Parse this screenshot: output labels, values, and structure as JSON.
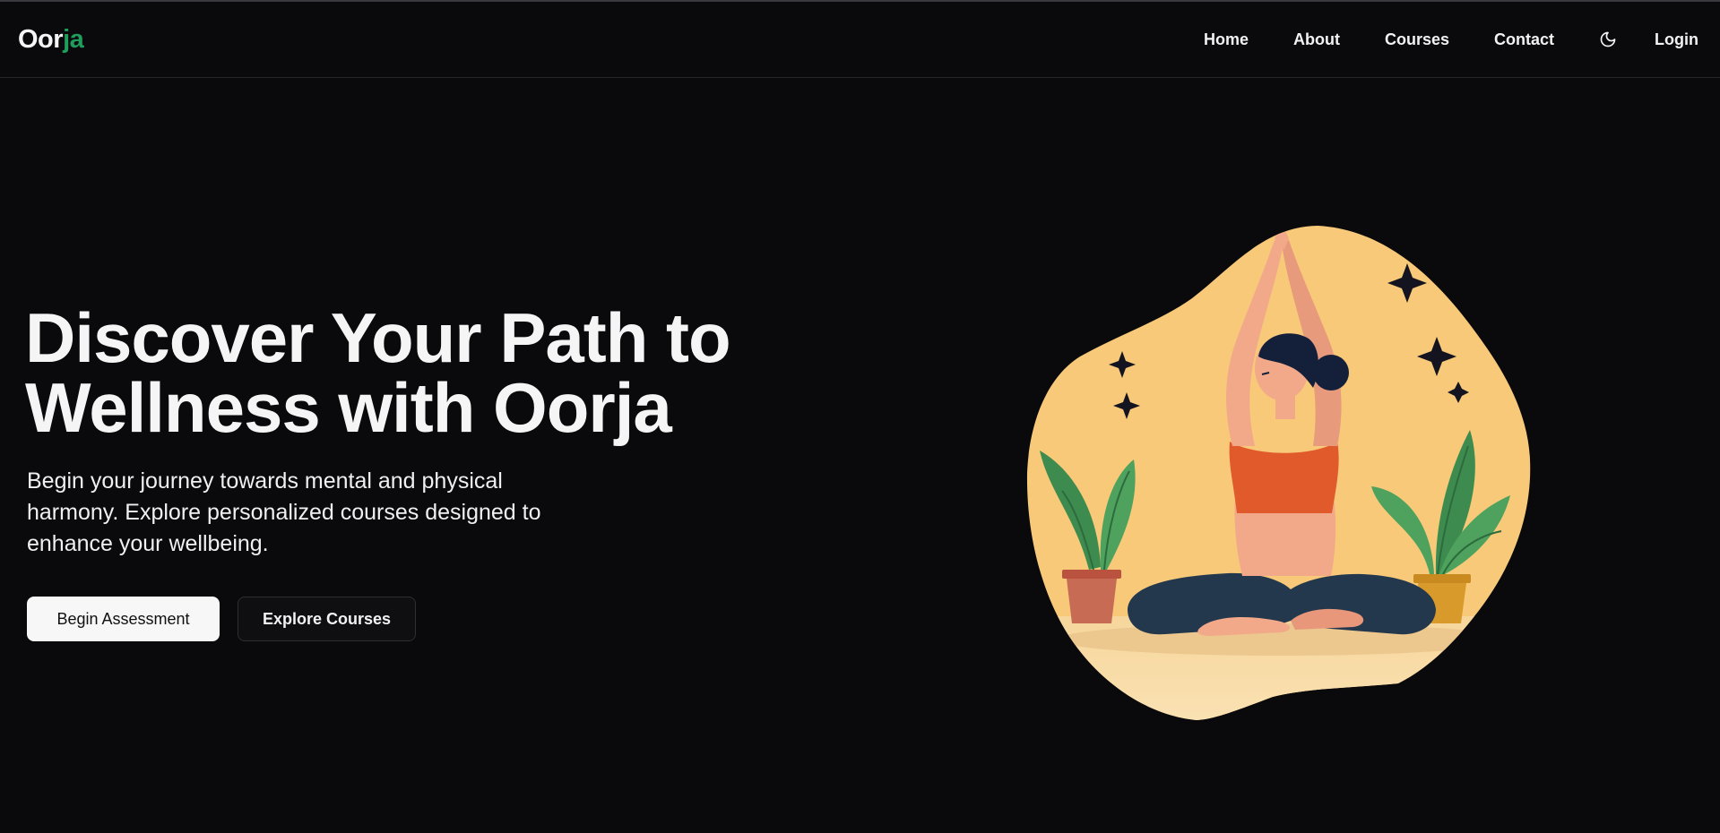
{
  "brand": {
    "logo_prefix": "Oor",
    "logo_suffix": "ja",
    "accent_color": "#1f9d5c"
  },
  "nav": {
    "items": [
      "Home",
      "About",
      "Courses",
      "Contact"
    ],
    "theme_icon": "moon-icon",
    "login_label": "Login"
  },
  "hero": {
    "title_line1": "Discover Your Path to",
    "title_line2": "Wellness with Oorja",
    "subtitle": "Begin your journey towards mental and physical harmony. Explore personalized courses designed to enhance your wellbeing.",
    "primary_button": "Begin Assessment",
    "secondary_button": "Explore Courses"
  },
  "illustration": {
    "subject": "yoga-meditation-illustration",
    "background_color": "#f7c979"
  }
}
